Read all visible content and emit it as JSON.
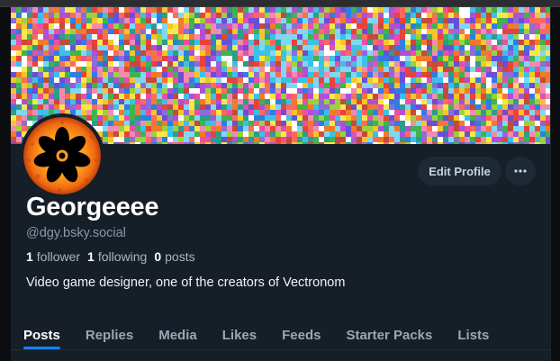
{
  "profile": {
    "display_name": "Georgeeee",
    "handle": "@dgy.bsky.social",
    "stats": {
      "followers_count": "1",
      "followers_label": "follower",
      "following_count": "1",
      "following_label": "following",
      "posts_count": "0",
      "posts_label": "posts"
    },
    "bio": "Video game designer, one of the creators of Vectronom"
  },
  "actions": {
    "edit_profile_label": "Edit Profile",
    "more_icon": "ellipsis-icon"
  },
  "tabs": [
    {
      "label": "Posts",
      "active": true
    },
    {
      "label": "Replies",
      "active": false
    },
    {
      "label": "Media",
      "active": false
    },
    {
      "label": "Likes",
      "active": false
    },
    {
      "label": "Feeds",
      "active": false
    },
    {
      "label": "Starter Packs",
      "active": false
    },
    {
      "label": "Lists",
      "active": false
    }
  ],
  "colors": {
    "panel_bg": "#161e27",
    "accent": "#1083fe",
    "text_primary": "#ffffff",
    "text_secondary": "#8a97a6",
    "button_bg": "#1e2936"
  }
}
